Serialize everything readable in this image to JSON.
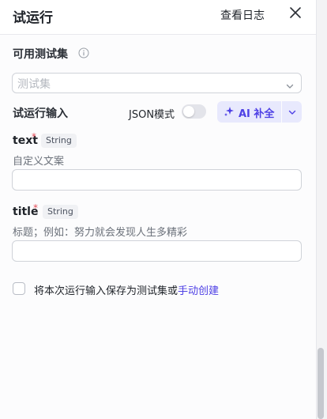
{
  "header": {
    "title": "试运行",
    "view_log": "查看日志"
  },
  "test_set": {
    "label": "可用测试集",
    "placeholder": "测试集"
  },
  "run_input": {
    "label": "试运行输入",
    "json_mode_label": "JSON模式",
    "json_mode_on": false,
    "ai_fill_label": "AI 补全"
  },
  "fields": [
    {
      "name": "text",
      "type": "String",
      "description": "自定义文案",
      "value": ""
    },
    {
      "name": "title",
      "type": "String",
      "description": "标题；例如：努力就会发现人生多精彩",
      "value": ""
    }
  ],
  "save": {
    "checked": false,
    "text": "将本次运行输入保存为测试集或",
    "link": "手动创建"
  },
  "colors": {
    "accent": "#4e40e5",
    "required": "#e34d59"
  }
}
